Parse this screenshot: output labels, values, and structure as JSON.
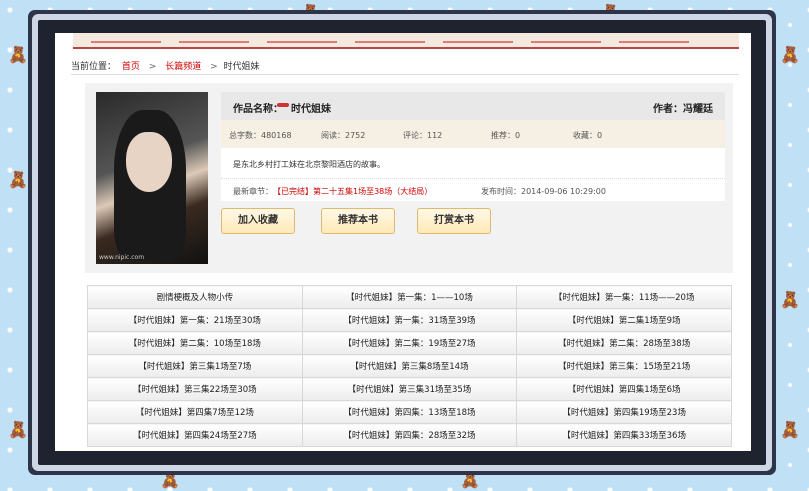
{
  "decor": {
    "bears": [
      "bear-icon"
    ]
  },
  "breadcrumb": {
    "prefix": "当前位置：",
    "items": [
      "首页",
      "长篇频道",
      "时代姐妹"
    ],
    "separator": ">"
  },
  "book": {
    "title_label": "作品名称：",
    "title": "时代姐妹",
    "author": "作者：冯耀廷",
    "stats": {
      "words": "总字数：480168",
      "reads": "阅读：2752",
      "comments": "评论：112",
      "recommends": "推荐：0",
      "favorites": "收藏：0"
    },
    "description": "是东北乡村打工妹在北京黎阳酒店的故事。",
    "latest_label": "最新章节：",
    "latest_chapter": "【已完结】第二十五集1场至38场（大结局）",
    "published": "发布时间：2014-09-06 10:29:00",
    "cover_mark": "www.nipic.com"
  },
  "buttons": {
    "favorite": "加入收藏",
    "recommend": "推荐本书",
    "reward": "打赏本书"
  },
  "chapters": [
    [
      "剧情梗概及人物小传",
      "【时代姐妹】第一集：1——10场",
      "【时代姐妹】第一集：11场——20场"
    ],
    [
      "【时代姐妹】第一集：21场至30场",
      "【时代姐妹】第一集：31场至39场",
      "【时代姐妹】第二集1场至9场"
    ],
    [
      "【时代姐妹】第二集：10场至18场",
      "【时代姐妹】第二集：19场至27场",
      "【时代姐妹】第二集：28场至38场"
    ],
    [
      "【时代姐妹】第三集1场至7场",
      "【时代姐妹】第三集8场至14场",
      "【时代姐妹】第三集：15场至21场"
    ],
    [
      "【时代姐妹】第三集22场至30场",
      "【时代姐妹】第三集31场至35场",
      "【时代姐妹】第四集1场至6场"
    ],
    [
      "【时代姐妹】第四集7场至12场",
      "【时代姐妹】第四集：13场至18场",
      "【时代姐妹】第四集19场至23场"
    ],
    [
      "【时代姐妹】第四集24场至27场",
      "【时代姐妹】第四集：28场至32场",
      "【时代姐妹】第四集33场至36场"
    ]
  ]
}
